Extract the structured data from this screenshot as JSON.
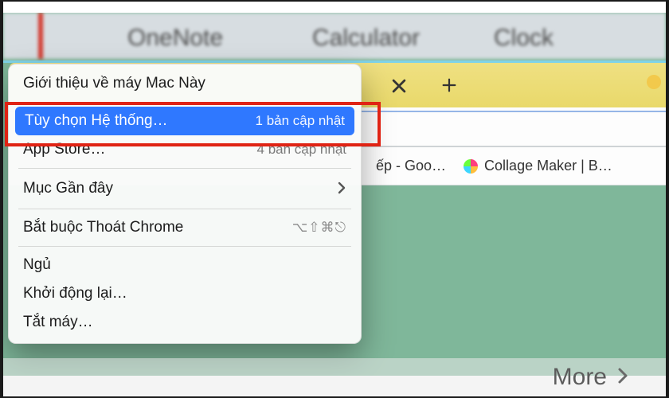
{
  "desktop": {
    "apps": {
      "onenote": "OneNote",
      "calculator": "Calculator",
      "clock": "Clock"
    }
  },
  "chrome": {
    "bookmarks": {
      "bep": "ếp - Goo…",
      "collage": "Collage Maker | B…"
    }
  },
  "menu": {
    "about": "Giới thiệu về máy Mac Này",
    "system_prefs": "Tùy chọn Hệ thống…",
    "system_prefs_hint": "1 bản cập nhật",
    "app_store": "App Store…",
    "app_store_hint": "4 bản cập nhật",
    "recent": "Mục Gần đây",
    "force_quit": "Bắt buộc Thoát Chrome",
    "force_quit_shortcut": "⌥⇧⌘⎋",
    "sleep": "Ngủ",
    "restart": "Khởi động lại…",
    "shutdown": "Tắt máy…"
  },
  "overlay": {
    "more": "More"
  }
}
